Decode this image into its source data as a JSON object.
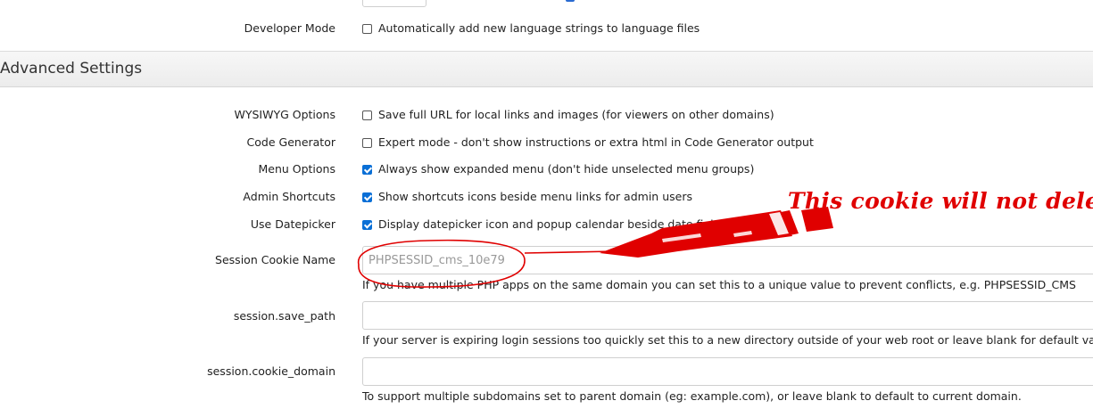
{
  "settings_top": {
    "developer_mode": {
      "label": "Developer Mode",
      "checkbox_label": "Automatically add new language strings to language files",
      "checked": false
    }
  },
  "advanced_settings": {
    "title": "Advanced Settings",
    "options": [
      {
        "label": "WYSIWYG Options",
        "checkbox_label": "Save full URL for local links and images (for viewers on other domains)",
        "checked": false
      },
      {
        "label": "Code Generator",
        "checkbox_label": "Expert mode - don't show instructions or extra html in Code Generator output",
        "checked": false
      },
      {
        "label": "Menu Options",
        "checkbox_label": "Always show expanded menu (don't hide unselected menu groups)",
        "checked": true
      },
      {
        "label": "Admin Shortcuts",
        "checkbox_label": "Show shortcuts icons beside menu links for admin users",
        "checked": true
      },
      {
        "label": "Use Datepicker",
        "checkbox_label": "Display datepicker icon and popup calendar beside date fields",
        "checked": true
      }
    ],
    "session_cookie_name": {
      "label": "Session Cookie Name",
      "placeholder": "PHPSESSID_cms_10e79",
      "value": "",
      "help": "If you have multiple PHP apps on the same domain you can set this to a unique value to prevent conflicts, e.g. PHPSESSID_CMS"
    },
    "session_save_path": {
      "label": "session.save_path",
      "value": "",
      "help": "If your server is expiring login sessions too quickly set this to a new directory outside of your web root or leave blank for default value of"
    },
    "session_cookie_domain": {
      "label": "session.cookie_domain",
      "value": "",
      "help": "To support multiple subdomains set to parent domain (eg: example.com), or leave blank to default to current domain."
    }
  },
  "annotation": {
    "text": "This cookie will not delete.",
    "color": "#e00000"
  },
  "colors": {
    "checkbox_checked": "#0a6fd6",
    "section_bar": "#f0f0f0"
  }
}
